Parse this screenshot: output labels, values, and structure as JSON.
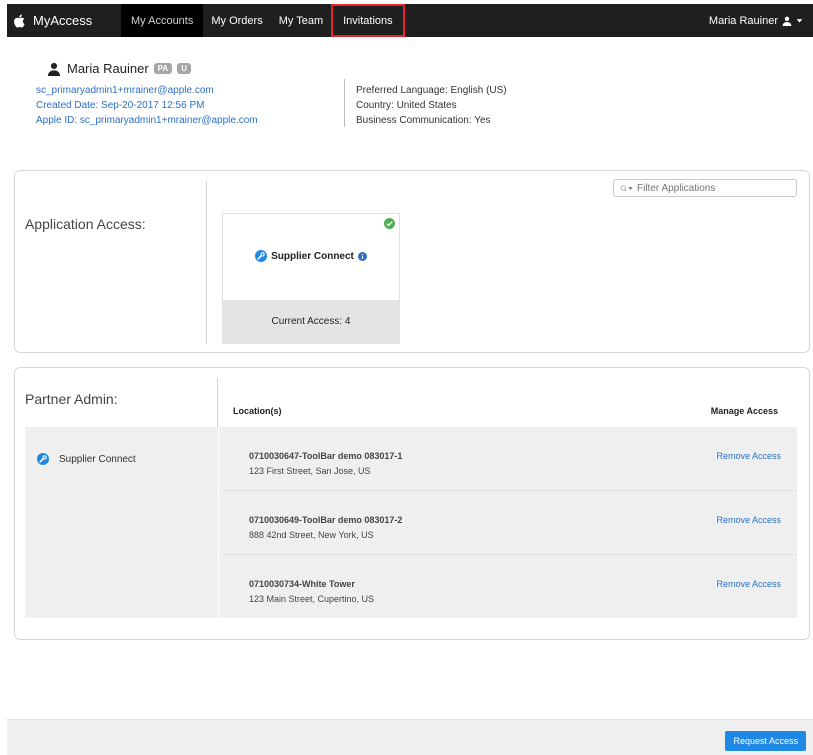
{
  "app": {
    "name": "MyAccess"
  },
  "nav": {
    "items": [
      {
        "label": "My Accounts",
        "active": true
      },
      {
        "label": "My Orders",
        "active": false
      },
      {
        "label": "My Team",
        "active": false
      },
      {
        "label": "Invitations",
        "active": false,
        "highlighted": true
      }
    ],
    "user": "Maria Rauiner"
  },
  "profile": {
    "name": "Maria Rauiner",
    "badges": [
      "PA",
      "U"
    ],
    "email": "sc_primaryadmin1+mrainer@apple.com",
    "created": "Created Date:  Sep-20-2017 12:56 PM",
    "apple_id": "Apple ID:   sc_primaryadmin1+mrainer@apple.com",
    "language": "Preferred Language: English (US)",
    "country": "Country:  United States",
    "business": "Business Communication:  Yes"
  },
  "application_access": {
    "title": "Application Access:",
    "filter_placeholder": "Filter Applications",
    "card": {
      "name": "Supplier Connect",
      "current_access": "Current Access: 4"
    }
  },
  "partner_admin": {
    "title": "Partner Admin:",
    "app_name": "Supplier Connect",
    "columns": {
      "location": "Location(s)",
      "manage": "Manage Access"
    },
    "rows": [
      {
        "name": "0710030647-ToolBar demo 083017-1",
        "address": "123 First Street, San Jose, US",
        "action": "Remove Access"
      },
      {
        "name": "0710030649-ToolBar demo 083017-2",
        "address": "888 42nd Street, New York, US",
        "action": "Remove Access"
      },
      {
        "name": "0710030734-White Tower",
        "address": "123 Main Street, Cupertino, US",
        "action": "Remove Access"
      }
    ]
  },
  "footer": {
    "request_button": "Request Access"
  },
  "colors": {
    "nav_bg": "#1f1f1f",
    "link": "#2d6fc4",
    "highlight": "#e8252b",
    "button": "#1e88e5",
    "success": "#4caf50"
  }
}
